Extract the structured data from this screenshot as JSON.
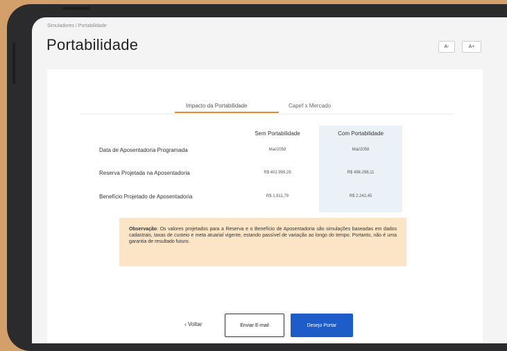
{
  "breadcrumb": "Simuladores / Portabilidade",
  "title": "Portabilidade",
  "font_controls": {
    "decrease": "A-",
    "increase": "A+"
  },
  "tabs": [
    {
      "label": "Impacto da Portabilidade",
      "active": true
    },
    {
      "label": "Capef x Mercado",
      "active": false
    }
  ],
  "columns": {
    "sem": "Sem Portabilidade",
    "com": "Com Portabilidade"
  },
  "rows": [
    {
      "label": "Data de Aposentadoria Programada",
      "sem": "Mai/2058",
      "com": "Mai/2058"
    },
    {
      "label": "Reserva Projetada na Aposentadoria",
      "sem": "R$ 402.999,28",
      "com": "R$ 498.298,11"
    },
    {
      "label": "Benefício Projetado de Aposentadoria",
      "sem": "R$ 1.811,79",
      "com": "R$ 2.242,45"
    }
  ],
  "observation": {
    "label": "Observação",
    "text": ": Os valores projetados para a Reserva e o Benefício de Aposentadoria são simulações baseadas em dados cadastrais, taxas de custeio e meta atuarial vigente, estando passível de variação ao longo do tempo. Portanto, não é uma garantia de resultado futuro."
  },
  "actions": {
    "back": "Voltar",
    "email": "Enviar E-mail",
    "portar": "Desejo Portar"
  },
  "colors": {
    "background": "#d3a06c",
    "accent": "#e08a2c",
    "primary": "#1e5cc8",
    "note": "#fce5c6",
    "highlight": "#eaf2f7"
  }
}
